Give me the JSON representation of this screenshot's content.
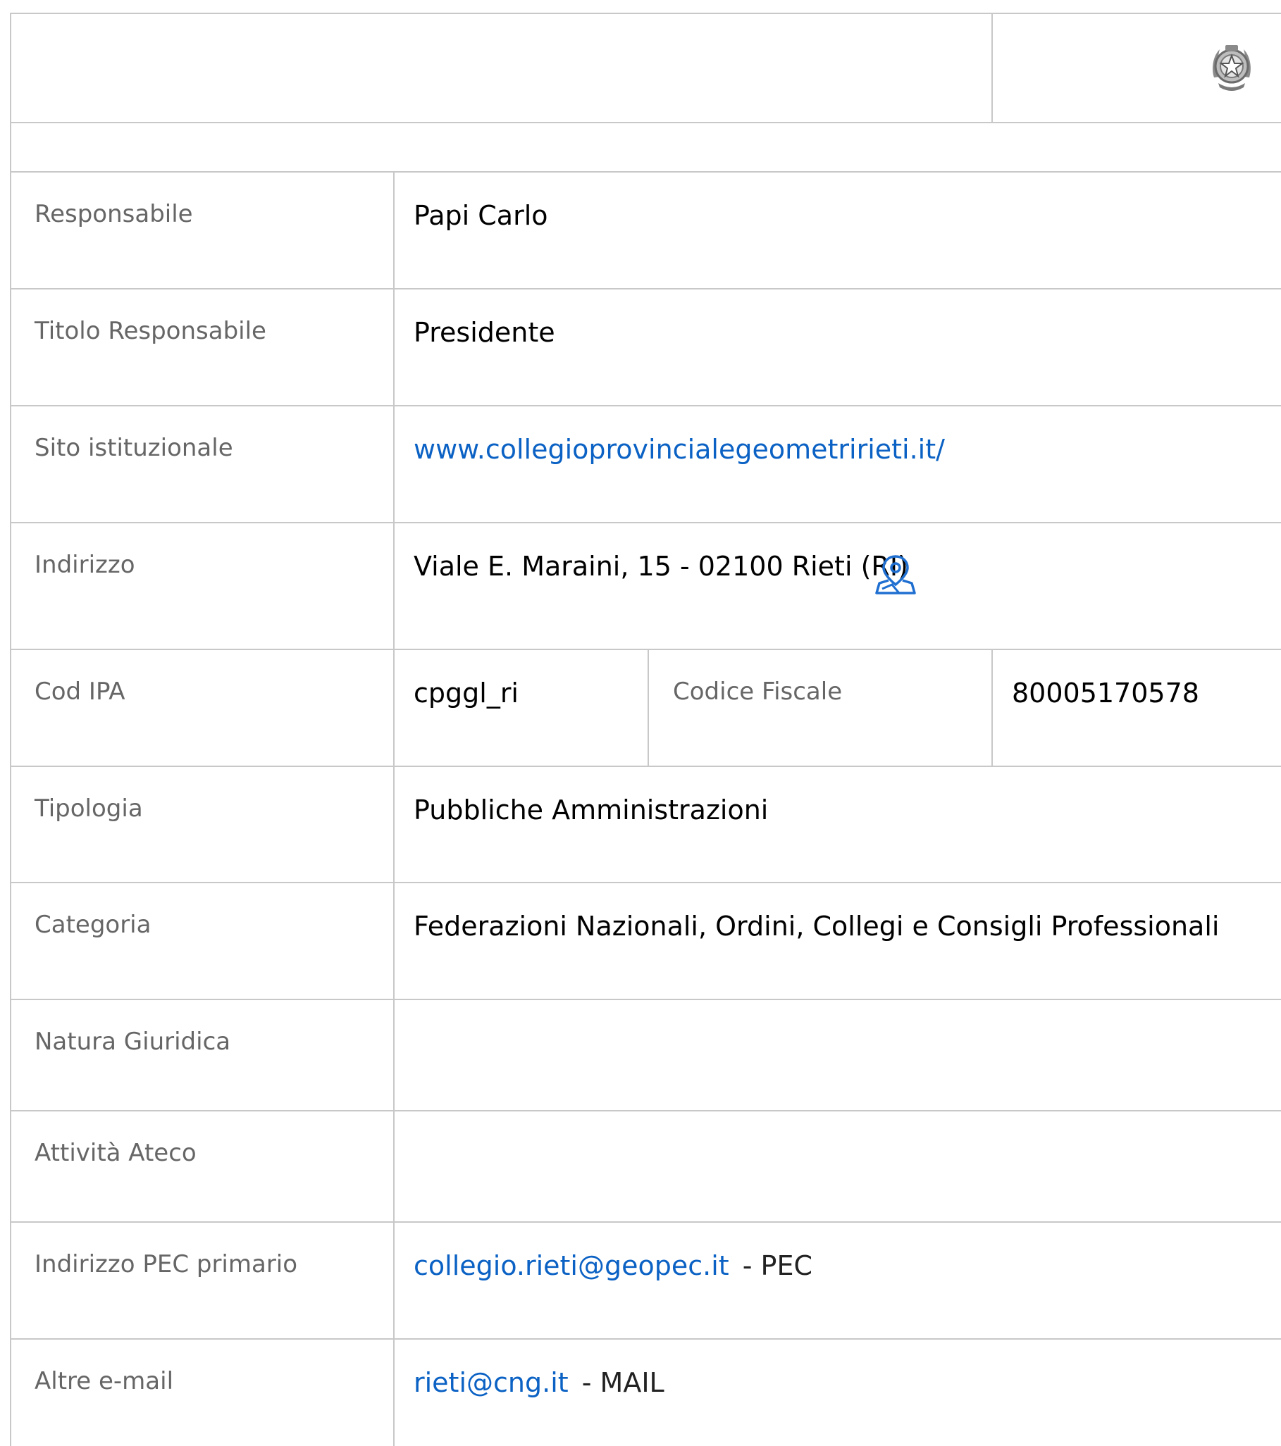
{
  "header": {
    "emblem_icon": "italian-republic-emblem"
  },
  "rows": [
    {
      "label": "Responsabile",
      "value": "Papi Carlo"
    },
    {
      "label": "Titolo Responsabile",
      "value": "Presidente"
    },
    {
      "label": "Sito istituzionale",
      "link": "www.collegioprovincialegeometririeti.it/"
    },
    {
      "label": "Indirizzo",
      "value": "Viale E. Maraini, 15 - 02100 Rieti (RI)",
      "icon": "map-pin-icon"
    },
    {
      "label": "Cod IPA",
      "value": "cpggl_ri",
      "label2": "Codice Fiscale",
      "value2": "80005170578"
    },
    {
      "label": "Tipologia",
      "value": "Pubbliche Amministrazioni"
    },
    {
      "label": "Categoria",
      "value": "Federazioni Nazionali, Ordini, Collegi e Consigli Professionali"
    },
    {
      "label": "Natura Giuridica",
      "value": ""
    },
    {
      "label": "Attività Ateco",
      "value": ""
    },
    {
      "label": "Indirizzo PEC primario",
      "link": "collegio.rieti@geopec.it",
      "suffix": "- PEC"
    },
    {
      "label": "Altre e-mail",
      "link": "rieti@cng.it",
      "suffix": "- MAIL"
    }
  ],
  "colors": {
    "border": "#c8c8c8",
    "label": "#666666",
    "value": "#000000",
    "link": "#0b62c4",
    "icon": "#1f6fd1"
  }
}
